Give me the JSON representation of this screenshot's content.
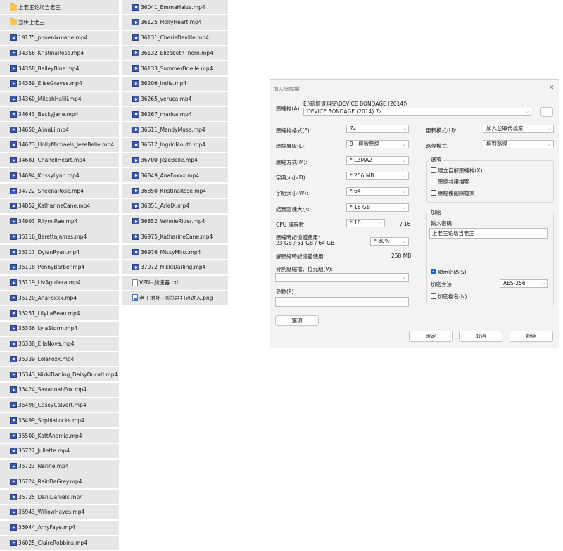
{
  "explorer": {
    "col1": [
      {
        "icon": "folder",
        "name": "上老王论坛当老王"
      },
      {
        "icon": "folder",
        "name": "宣传上老王"
      },
      {
        "icon": "video",
        "name": "19175_phoenixmarie.mp4"
      },
      {
        "icon": "video",
        "name": "34356_KristinaRose.mp4"
      },
      {
        "icon": "video",
        "name": "34358_BaileyBlue.mp4"
      },
      {
        "icon": "video",
        "name": "34359_EliseGraves.mp4"
      },
      {
        "icon": "video",
        "name": "34360_MilcahHalili.mp4"
      },
      {
        "icon": "video",
        "name": "34643_BeckyJane.mp4"
      },
      {
        "icon": "video",
        "name": "34650_AlinaLi.mp4"
      },
      {
        "icon": "video",
        "name": "34673_HollyMichaels_JezeBelle.mp4"
      },
      {
        "icon": "video",
        "name": "34681_ChanellHeart.mp4"
      },
      {
        "icon": "video",
        "name": "34694_KrissyLynn.mp4"
      },
      {
        "icon": "video",
        "name": "34722_SheenaRose.mp4"
      },
      {
        "icon": "video",
        "name": "34852_KatharineCane.mp4"
      },
      {
        "icon": "video",
        "name": "34903_RilynnRae.mp4"
      },
      {
        "icon": "video",
        "name": "35116_BerettaJames.mp4"
      },
      {
        "icon": "video",
        "name": "35117_DylanRyan.mp4"
      },
      {
        "icon": "video",
        "name": "35118_PennyBarber.mp4"
      },
      {
        "icon": "video",
        "name": "35119_LivAguilera.mp4"
      },
      {
        "icon": "video",
        "name": "35120_AnaFoxxx.mp4"
      },
      {
        "icon": "video",
        "name": "35251_LilyLaBeau.mp4"
      },
      {
        "icon": "video",
        "name": "35336_LylaStorm.mp4"
      },
      {
        "icon": "video",
        "name": "35338_EllaNova.mp4"
      },
      {
        "icon": "video",
        "name": "35339_LolaFoxx.mp4"
      },
      {
        "icon": "video",
        "name": "35343_NikkiDarling_DaisyDucati.mp4"
      },
      {
        "icon": "video",
        "name": "35424_SavannahFox.mp4"
      },
      {
        "icon": "video",
        "name": "35498_CaseyCalvert.mp4"
      },
      {
        "icon": "video",
        "name": "35499_SophiaLocke.mp4"
      },
      {
        "icon": "video",
        "name": "35500_KattAnomia.mp4"
      },
      {
        "icon": "video",
        "name": "35722_Juliette.mp4"
      },
      {
        "icon": "video",
        "name": "35723_Nerine.mp4"
      },
      {
        "icon": "video",
        "name": "35724_RainDeGrey.mp4"
      },
      {
        "icon": "video",
        "name": "35725_DaniDaniels.mp4"
      },
      {
        "icon": "video",
        "name": "35943_WillowHayes.mp4"
      },
      {
        "icon": "video",
        "name": "35944_AmyFaye.mp4"
      },
      {
        "icon": "video",
        "name": "36025_ClaireRobbins.mp4"
      }
    ],
    "col2": [
      {
        "icon": "video",
        "name": "36041_EmmaHaize.mp4"
      },
      {
        "icon": "video",
        "name": "36125_HollyHeart.mp4"
      },
      {
        "icon": "video",
        "name": "36131_CherieDeville.mp4"
      },
      {
        "icon": "video",
        "name": "36132_ElizabethThorn.mp4"
      },
      {
        "icon": "video",
        "name": "36133_SummerBrielle.mp4"
      },
      {
        "icon": "video",
        "name": "36206_india.mp4"
      },
      {
        "icon": "video",
        "name": "36265_veruca.mp4"
      },
      {
        "icon": "video",
        "name": "36267_marica.mp4"
      },
      {
        "icon": "video",
        "name": "36611_MandyMuse.mp4"
      },
      {
        "icon": "video",
        "name": "36612_IngridMouth.mp4"
      },
      {
        "icon": "video",
        "name": "36700_JezeBelle.mp4"
      },
      {
        "icon": "video",
        "name": "36849_AnaFoxxx.mp4"
      },
      {
        "icon": "video",
        "name": "36850_KristinaRose.mp4"
      },
      {
        "icon": "video",
        "name": "36851_ArielX.mp4"
      },
      {
        "icon": "video",
        "name": "36852_WinnieRider.mp4"
      },
      {
        "icon": "video",
        "name": "36975_KatharineCane.mp4"
      },
      {
        "icon": "video",
        "name": "36976_MissyMinx.mp4"
      },
      {
        "icon": "video",
        "name": "37072_NikkiDarling.mp4"
      },
      {
        "icon": "txt",
        "name": "VPN--加速器.txt"
      },
      {
        "icon": "png",
        "name": "老王地址--浏览器扫码进入.png"
      }
    ]
  },
  "dialog": {
    "title": "加入壓縮檔",
    "close": "✕",
    "archive_label": "壓縮檔(A):",
    "archive_dir": "E:\\新增資料夾\\DEVICE BONDAGE (2014)\\",
    "archive_name": "DEVICE BONDAGE (2014).7z",
    "browse": "...",
    "format_label": "壓縮檔格式(F):",
    "format": "7z",
    "level_label": "壓縮層級(L):",
    "level": "9 - 極致壓縮",
    "method_label": "壓縮方式(M):",
    "method": "* LZMA2",
    "dict_label": "字典大小(D):",
    "dict": "* 256 MB",
    "word_label": "字組大小(W):",
    "word": "* 64",
    "solid_label": "結實區塊大小:",
    "solid": "* 16 GB",
    "cpu_label": "CPU 線程數:",
    "cpu": "* 16",
    "cpu_total": "/ 16",
    "mem_label": "壓縮時記憶體使用:",
    "mem_values": "23 GB / 51 GB / 64 GB",
    "mem_pct": "* 80%",
    "decomp_label": "解壓縮時記憶體使用:",
    "decomp_value": "258 MB",
    "split_label": "分割壓縮檔，位元組(V):",
    "params_label": "參數(P):",
    "options_btn": "選項",
    "update_label": "更新模式(U):",
    "update": "加入並取代檔案",
    "path_label": "路徑模式:",
    "path": "相對路徑",
    "opts_title": "選項",
    "opt_sfx": "建立自解壓縮檔(X)",
    "opt_shared": "壓縮共用檔案",
    "opt_delete": "壓縮後刪除檔案",
    "enc_title": "加密",
    "pwd_label": "輸入密碼:",
    "pwd_value": "上老王论坛当老王",
    "show_pwd": "顯示密碼(S)",
    "enc_method_label": "加密方法:",
    "enc_method": "AES-256",
    "enc_names": "加密檔名(N)",
    "ok": "確定",
    "cancel": "取消",
    "help": "說明"
  }
}
